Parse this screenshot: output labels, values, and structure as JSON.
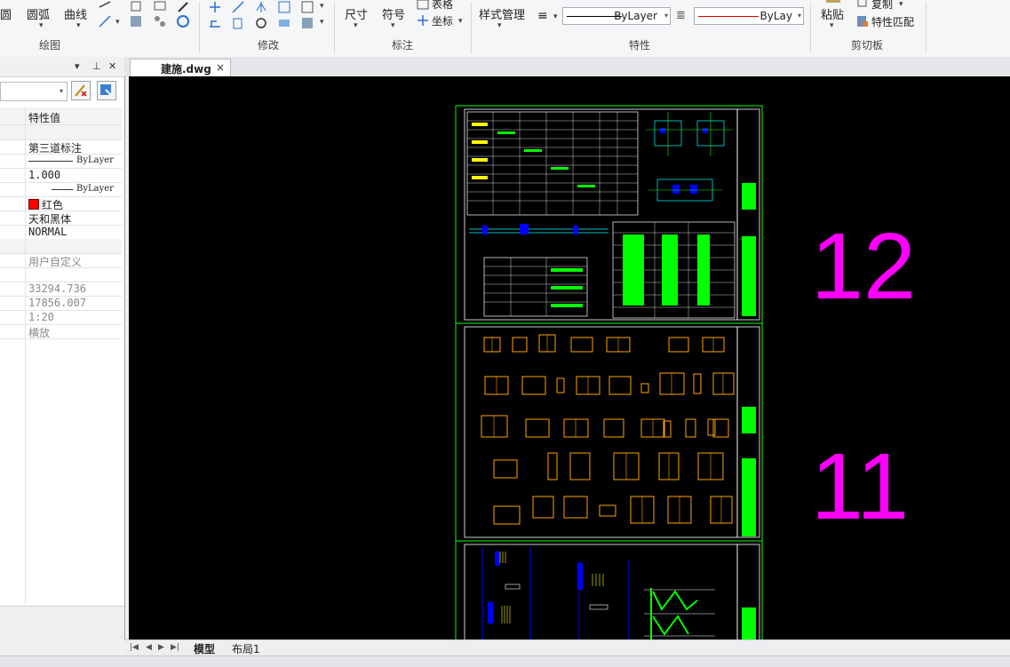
{
  "ribbon": {
    "draw": {
      "arc": "圆弧",
      "curve": "曲线",
      "circle_partial": "圆",
      "label": "绘图"
    },
    "modify": {
      "label": "修改"
    },
    "annotate": {
      "dim": "尺寸",
      "symbol": "符号",
      "table": "表格",
      "coord": "坐标",
      "label": "标注"
    },
    "properties": {
      "style_mgr": "样式管理",
      "linetype_value": "ByLayer",
      "color_value": "ByLay",
      "label": "特性"
    },
    "clipboard": {
      "paste": "粘贴",
      "copy": "复制",
      "match": "特性匹配",
      "label": "剪切板"
    }
  },
  "palette": {
    "header_col": "特性值",
    "rows": [
      {
        "value": "第三道标注"
      },
      {
        "value": "ByLayer"
      },
      {
        "value": "1.000"
      },
      {
        "value": "ByLayer"
      },
      {
        "value": "红色"
      },
      {
        "value": "天和黑体"
      },
      {
        "value": "NORMAL"
      },
      {
        "value": ""
      },
      {
        "value": "用户自定义"
      },
      {
        "value": ""
      },
      {
        "value": "33294.736"
      },
      {
        "value": "17856.007"
      },
      {
        "value": "1:20"
      },
      {
        "value": "横放"
      }
    ]
  },
  "document": {
    "tab_title": "建施.dwg",
    "close": "×"
  },
  "canvas": {
    "sheet_labels": [
      "12",
      "11"
    ]
  },
  "layout_tabs": {
    "model": "模型",
    "layout1": "布局1"
  },
  "colors": {
    "canvas_bg": "#000000",
    "frame": "#00ff00",
    "window": "#ffa500",
    "label": "#ff00ff",
    "red": "#ff0000"
  }
}
